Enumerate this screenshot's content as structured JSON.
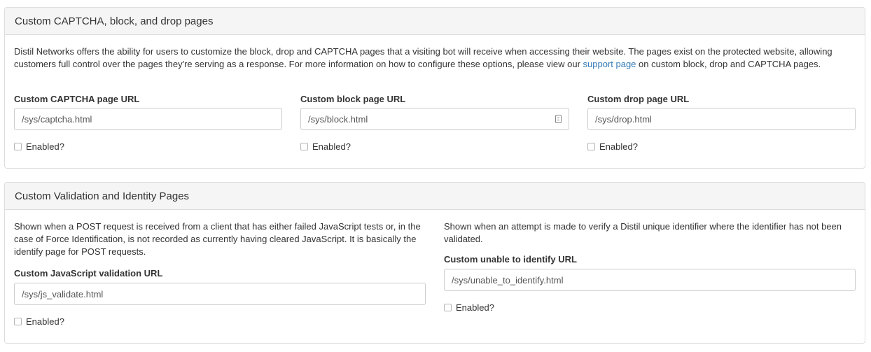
{
  "captcha_panel": {
    "title": "Custom CAPTCHA, block, and drop pages",
    "desc_before": "Distil Networks offers the ability for users to customize the block, drop and CAPTCHA pages that a visiting bot will receive when accessing their website. The pages exist on the protected website, allowing customers full control over the pages they're serving as a response. For more information on how to configure these options, please view our ",
    "desc_link": "support page",
    "desc_after": " on custom block, drop and CAPTCHA pages.",
    "fields": [
      {
        "label": "Custom CAPTCHA page URL",
        "value": "/sys/captcha.html",
        "enabled_label": "Enabled?"
      },
      {
        "label": "Custom block page URL",
        "value": "/sys/block.html",
        "enabled_label": "Enabled?"
      },
      {
        "label": "Custom drop page URL",
        "value": "/sys/drop.html",
        "enabled_label": "Enabled?"
      }
    ]
  },
  "validation_panel": {
    "title": "Custom Validation and Identity Pages",
    "left": {
      "desc": "Shown when a POST request is received from a client that has either failed JavaScript tests or, in the case of Force Identification, is not recorded as currently having cleared JavaScript. It is basically the identify page for POST requests.",
      "label": "Custom JavaScript validation URL",
      "value": "/sys/js_validate.html",
      "enabled_label": "Enabled?"
    },
    "right": {
      "desc": "Shown when an attempt is made to verify a Distil unique identifier where the identifier has not been validated.",
      "label": "Custom unable to identify URL",
      "value": "/sys/unable_to_identify.html",
      "enabled_label": "Enabled?"
    }
  },
  "icons": {
    "field_icon": "contact-card-icon",
    "link_color": "#337ab7"
  }
}
